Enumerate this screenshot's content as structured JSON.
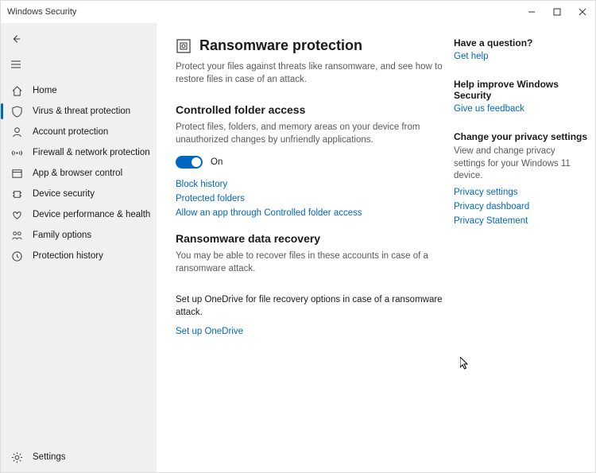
{
  "titlebar": {
    "title": "Windows Security"
  },
  "nav": {
    "items": [
      {
        "label": "Home"
      },
      {
        "label": "Virus & threat protection"
      },
      {
        "label": "Account protection"
      },
      {
        "label": "Firewall & network protection"
      },
      {
        "label": "App & browser control"
      },
      {
        "label": "Device security"
      },
      {
        "label": "Device performance & health"
      },
      {
        "label": "Family options"
      },
      {
        "label": "Protection history"
      }
    ],
    "settings": "Settings"
  },
  "page": {
    "title": "Ransomware protection",
    "subtitle": "Protect your files against threats like ransomware, and see how to restore files in case of an attack.",
    "section1": {
      "heading": "Controlled folder access",
      "desc": "Protect files, folders, and memory areas on your device from unauthorized changes by unfriendly applications.",
      "toggle_state": "On",
      "links": {
        "block_history": "Block history",
        "protected_folders": "Protected folders",
        "allow_app": "Allow an app through Controlled folder access"
      }
    },
    "section2": {
      "heading": "Ransomware data recovery",
      "desc": "You may be able to recover files in these accounts in case of a ransomware attack.",
      "body": "Set up OneDrive for file recovery options in case of a ransomware attack.",
      "link": "Set up OneDrive"
    }
  },
  "side": {
    "question": {
      "head": "Have a question?",
      "link": "Get help"
    },
    "improve": {
      "head": "Help improve Windows Security",
      "link": "Give us feedback"
    },
    "privacy": {
      "head": "Change your privacy settings",
      "text": "View and change privacy settings for your Windows 11 device.",
      "links": {
        "a": "Privacy settings",
        "b": "Privacy dashboard",
        "c": "Privacy Statement"
      }
    }
  }
}
